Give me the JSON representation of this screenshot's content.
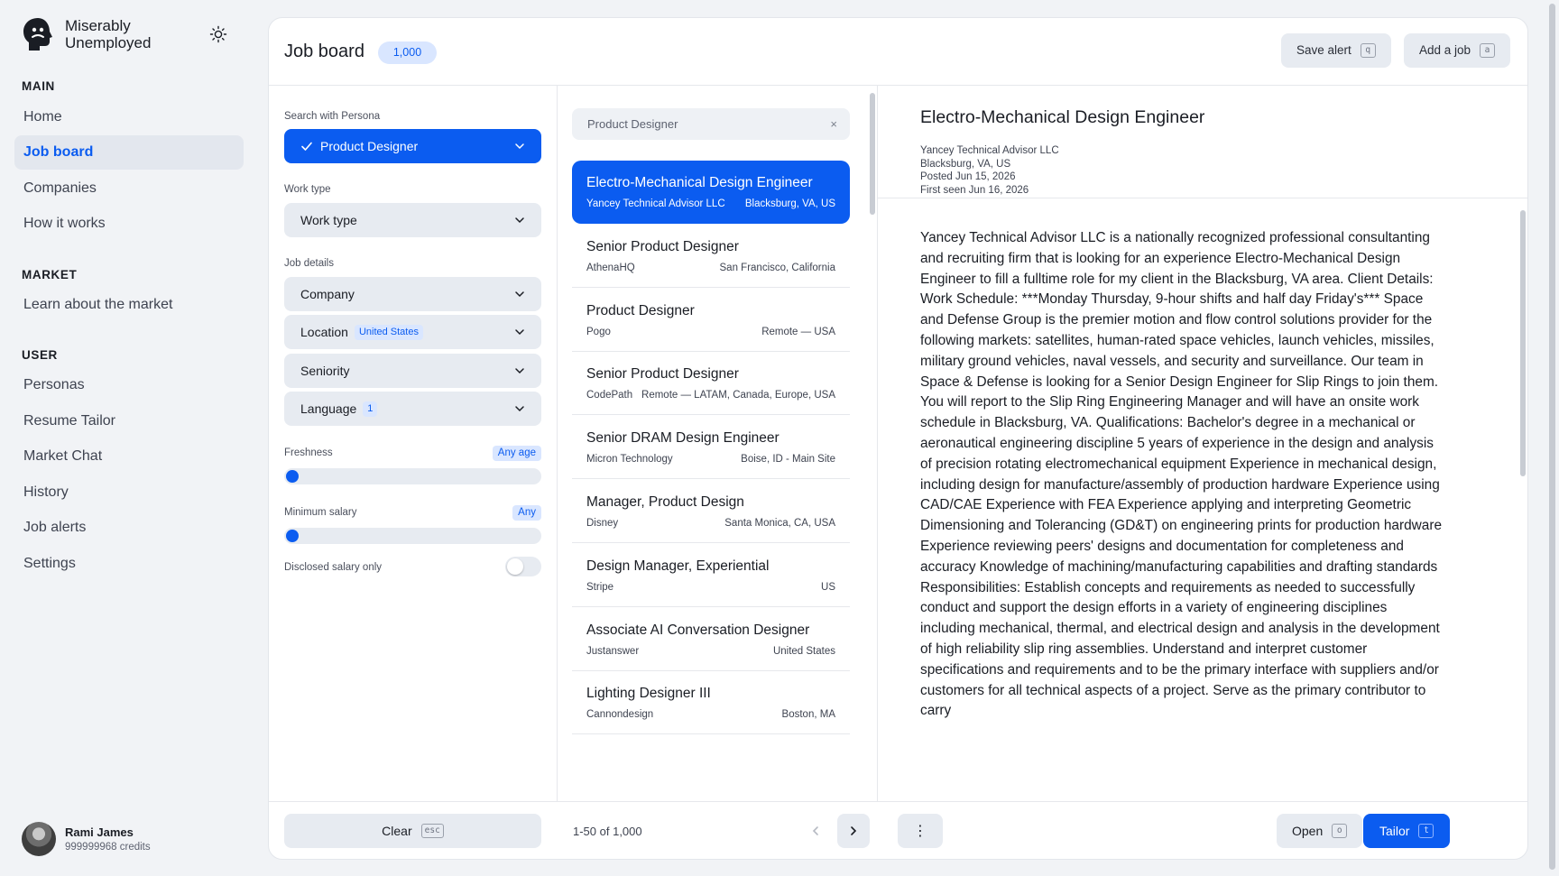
{
  "app": {
    "name_line1": "Miserably",
    "name_line2": "Unemployed"
  },
  "nav": {
    "sections": [
      {
        "title": "MAIN",
        "items": [
          "Home",
          "Job board",
          "Companies",
          "How it works"
        ]
      },
      {
        "title": "MARKET",
        "items": [
          "Learn about the market"
        ]
      },
      {
        "title": "USER",
        "items": [
          "Personas",
          "Resume Tailor",
          "Market Chat",
          "History",
          "Job alerts",
          "Settings"
        ]
      }
    ],
    "active": "Job board"
  },
  "user": {
    "name": "Rami James",
    "credits": "999999968 credits"
  },
  "header": {
    "title": "Job board",
    "count": "1,000",
    "save_alert": {
      "label": "Save alert",
      "key": "q"
    },
    "add_job": {
      "label": "Add a job",
      "key": "a"
    }
  },
  "filters": {
    "persona_label": "Search with Persona",
    "persona_value": "Product Designer",
    "work_type_label": "Work type",
    "work_type_value": "Work type",
    "job_details_label": "Job details",
    "company": "Company",
    "location": "Location",
    "location_chip": "United States",
    "seniority": "Seniority",
    "language": "Language",
    "language_chip": "1",
    "freshness_label": "Freshness",
    "freshness_value": "Any age",
    "freshness_level": 0,
    "min_salary_label": "Minimum salary",
    "min_salary_value": "Any",
    "min_salary_level": 0,
    "disclosed_label": "Disclosed salary only",
    "disclosed_on": false
  },
  "search": {
    "query": "Product Designer",
    "clear": "×"
  },
  "jobs": [
    {
      "title": "Electro-Mechanical Design Engineer",
      "company": "Yancey Technical Advisor LLC",
      "location": "Blacksburg, VA, US"
    },
    {
      "title": "Senior Product Designer",
      "company": "AthenaHQ",
      "location": "San Francisco, California"
    },
    {
      "title": "Product Designer",
      "company": "Pogo",
      "location": "Remote — USA"
    },
    {
      "title": "Senior Product Designer",
      "company": "CodePath",
      "location": "Remote — LATAM, Canada, Europe, USA"
    },
    {
      "title": "Senior DRAM Design Engineer",
      "company": "Micron Technology",
      "location": "Boise, ID - Main Site"
    },
    {
      "title": "Manager, Product Design",
      "company": "Disney",
      "location": "Santa Monica, CA, USA"
    },
    {
      "title": "Design Manager, Experiential",
      "company": "Stripe",
      "location": "US"
    },
    {
      "title": "Associate AI Conversation Designer",
      "company": "Justanswer",
      "location": "United States"
    },
    {
      "title": "Lighting Designer III",
      "company": "Cannondesign",
      "location": "Boston, MA"
    }
  ],
  "detail": {
    "title": "Electro-Mechanical Design Engineer",
    "company": "Yancey Technical Advisor LLC",
    "location": "Blacksburg, VA, US",
    "posted": "Posted Jun 15, 2026",
    "first_seen": "First seen Jun 16, 2026",
    "description": "Yancey Technical Advisor LLC is a nationally recognized professional consultanting and recruiting firm that is looking for an experience Electro-Mechanical Design Engineer to fill a fulltime role for my client in the Blacksburg, VA area. Client Details: Work Schedule: ***Monday Thursday, 9-hour shifts and half day Friday's*** Space and Defense Group is the premier motion and flow control solutions provider for the following markets: satellites, human-rated space vehicles, launch vehicles, missiles, military ground vehicles, naval vessels, and security and surveillance. Our team in Space & Defense is looking for a Senior Design Engineer for Slip Rings to join them. You will report to the Slip Ring Engineering Manager and will have an onsite work schedule in Blacksburg, VA. Qualifications: Bachelor's degree in a mechanical or aeronautical engineering discipline 5 years of experience in the design and analysis of precision rotating electromechanical equipment Experience in mechanical design, including design for manufacture/assembly of production hardware Experience using CAD/CAE Experience with FEA Experience applying and interpreting Geometric Dimensioning and Tolerancing (GD&T) on engineering prints for production hardware Experience reviewing peers' designs and documentation for completeness and accuracy Knowledge of machining/manufacturing capabilities and drafting standards Responsibilities: Establish concepts and requirements as needed to successfully conduct and support the design efforts in a variety of engineering disciplines including mechanical, thermal, and electrical design and analysis in the development of high reliability slip ring assemblies. Understand and interpret customer specifications and requirements and to be the primary interface with suppliers and/or customers for all technical aspects of a project. Serve as the primary contributor to carry"
  },
  "footer": {
    "clear_label": "Clear",
    "clear_key": "esc",
    "pager": "1-50 of 1,000",
    "more": "⋮",
    "open_label": "Open",
    "open_key": "o",
    "tailor_label": "Tailor",
    "tailor_key": "t"
  },
  "colors": {
    "accent": "#0b5cf0",
    "accent_soft": "#d9e6ff",
    "surface": "#e7ebf1"
  }
}
